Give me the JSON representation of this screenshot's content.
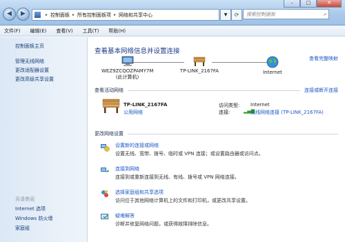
{
  "address": {
    "crumbs": [
      "控制面板",
      "所有控制面板项",
      "网络和共享中心"
    ]
  },
  "search": {
    "placeholder": "搜索控制面板"
  },
  "menu": [
    "文件(F)",
    "编辑(E)",
    "查看(V)",
    "工具(T)",
    "帮助(H)"
  ],
  "sidebar": {
    "items": [
      "控制面板主页",
      "管理无线网络",
      "更改适配器设置",
      "更改高级共享设置"
    ],
    "see_also_title": "另请参阅",
    "see_also": [
      "Internet 选项",
      "Windows 防火墙",
      "家庭组"
    ]
  },
  "main": {
    "title": "查看基本网络信息并设置连接",
    "full_map_link": "查看完整映射",
    "map": {
      "computer": "WEZ9ZCQOZPAMY7M",
      "computer_sub": "(此计算机)",
      "network": "TP-LINK_2167FA",
      "internet": "Internet"
    },
    "active": {
      "header": "查看活动网络",
      "connect_link": "连接或断开连接",
      "network_name": "TP-LINK_2167FA",
      "network_type": "公用网络",
      "access_label": "访问类型:",
      "access_value": "Internet",
      "conn_label": "连接:",
      "conn_value": "无线网络连接 (TP-LINK_2167FA)"
    },
    "change": {
      "header": "更改网络设置",
      "tasks": [
        {
          "title": "设置新的连接或网络",
          "desc": "设置无线、宽带、拨号、临时或 VPN 连接；或设置路由器或访问点。"
        },
        {
          "title": "连接到网络",
          "desc": "连接到或重新连接到无线、有线、拨号或 VPN 网络连接。"
        },
        {
          "title": "选择家庭组和共享选项",
          "desc": "访问位于其他网络计算机上的文件和打印机，或更改共享设置。"
        },
        {
          "title": "疑难解答",
          "desc": "诊断并修复网络问题，或获得故障排除信息。"
        }
      ]
    }
  },
  "colors": {
    "link": "#1a56c4",
    "title": "#1e3a8a",
    "public_network": "#1a56c4"
  }
}
